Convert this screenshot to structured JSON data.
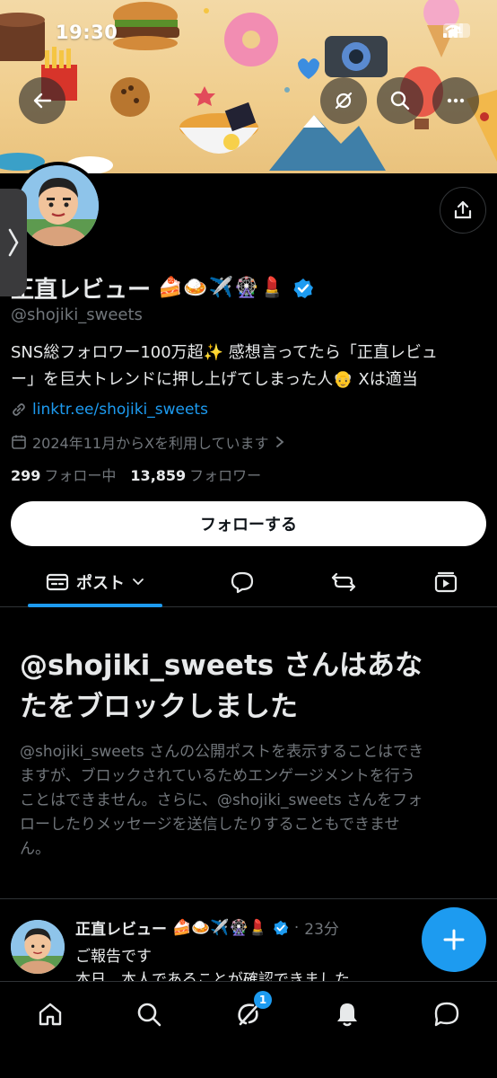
{
  "status_bar": {
    "time": "19:30",
    "battery": "21"
  },
  "profile": {
    "display_name": "正直レビュー",
    "name_emojis": "🍰🍛✈️🎡💄",
    "handle": "@shojiki_sweets",
    "bio_line1": "SNS総フォロワー100万超✨ 感想言ってたら「正直レビュ",
    "bio_line2": "ー」を巨大トレンドに押し上げてしまった人👴 Xは適当",
    "link": "linktr.ee/shojiki_sweets",
    "joined": "2024年11月からXを利用しています",
    "following_count": "299",
    "following_label": "フォロー中",
    "followers_count": "13,859",
    "followers_label": "フォロワー",
    "follow_button": "フォローする"
  },
  "tabs": {
    "posts_label": "ポスト"
  },
  "blocked": {
    "title_line1": "@shojiki_sweets さんはあな",
    "title_line2": "たをブロックしました",
    "desc_line1": "@shojiki_sweets さんの公開ポストを表示することはでき",
    "desc_line2": "ますが、ブロックされているためエンゲージメントを行う",
    "desc_line3": "ことはできません。さらに、@shojiki_sweets さんをフォ",
    "desc_line4": "ローしたりメッセージを送信したりすることもできませ",
    "desc_line5": "ん。"
  },
  "post": {
    "name": "正直レビュー",
    "emojis": "🍰🍛✈️🎡💄",
    "time": "23分",
    "line1": "ご報告です",
    "line2": "本日、本人であることが確認できました"
  },
  "nav": {
    "messages_badge": "1"
  },
  "colors": {
    "accent": "#1d9bf0",
    "background": "#000000",
    "secondary_text": "#71767b"
  },
  "icons": [
    "back-arrow-icon",
    "hide-icon",
    "search-icon",
    "more-icon",
    "share-icon",
    "link-icon",
    "calendar-icon",
    "posts-tab-icon",
    "replies-icon",
    "retweet-icon",
    "media-icon",
    "plus-icon",
    "home-icon",
    "grok-icon",
    "bell-icon",
    "chat-icon",
    "verified-badge-icon",
    "chevron-right-icon",
    "chevron-down-icon"
  ]
}
